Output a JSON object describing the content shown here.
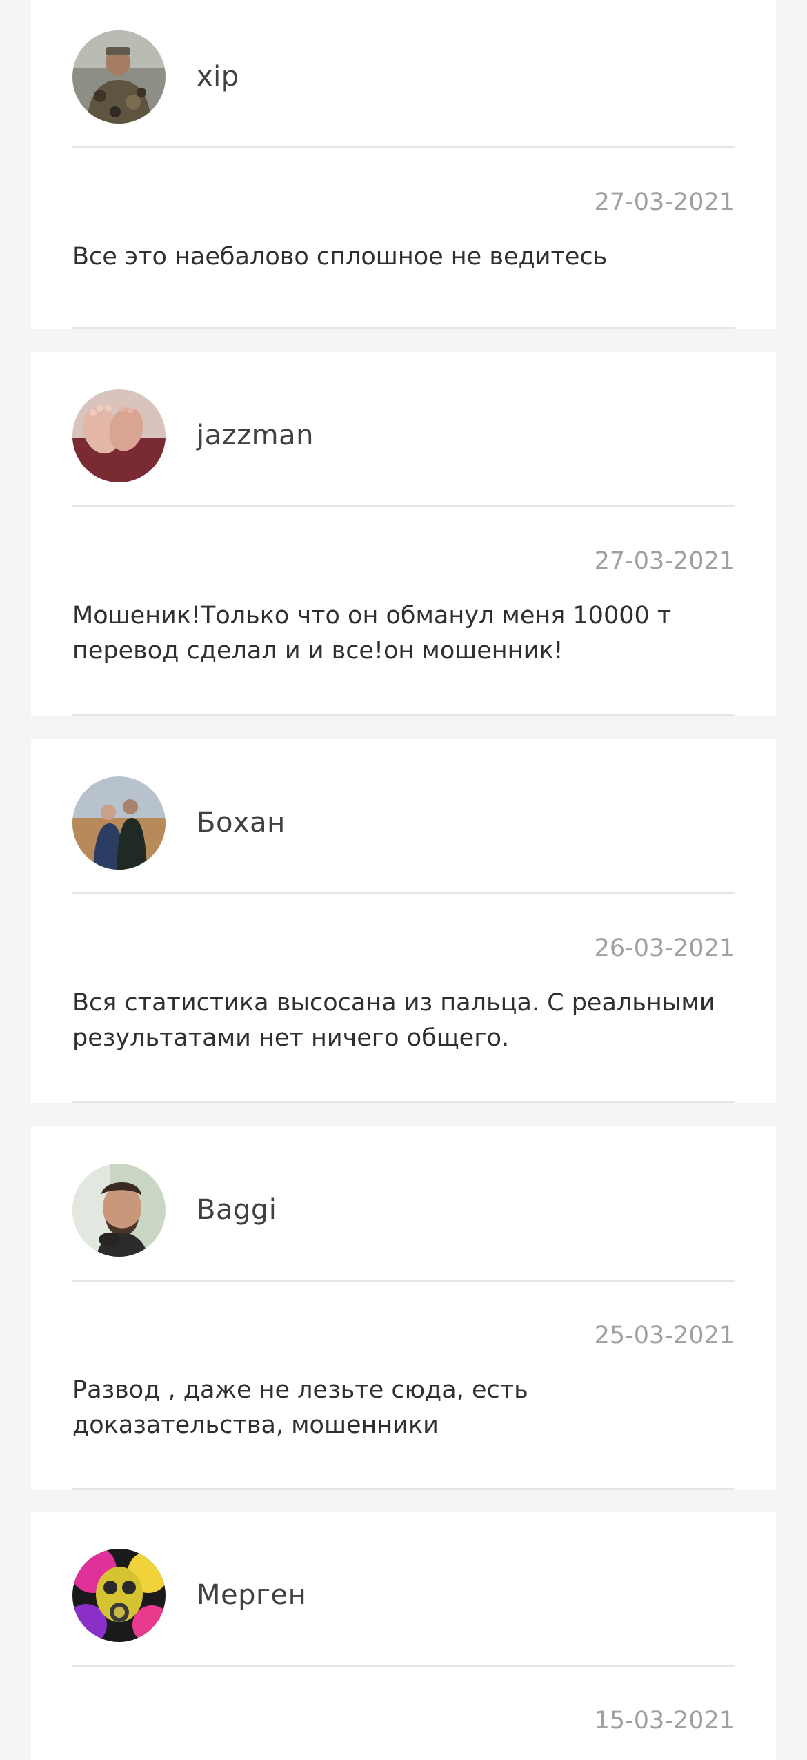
{
  "reviews": [
    {
      "username": "xip",
      "date": "27-03-2021",
      "text": "Все это наебалово сплошное не ведитесь",
      "avatar_icon": "user-photo-camouflage"
    },
    {
      "username": "jazzman",
      "date": "27-03-2021",
      "text": "Мошеник!Только что он обманул меня 10000 т перевод сделал и и все!он мошенник!",
      "avatar_icon": "user-photo-baby-feet"
    },
    {
      "username": "Бохан",
      "date": "26-03-2021",
      "text": "Вся статистика высосана из пальца. С реальными результатами нет ничего общего.",
      "avatar_icon": "user-photo-couple"
    },
    {
      "username": "Baggi",
      "date": "25-03-2021",
      "text": "Развод , даже не лезьте сюда, есть доказательства, мошенники",
      "avatar_icon": "user-photo-portrait"
    },
    {
      "username": "Мерген",
      "date": "15-03-2021",
      "text": "",
      "avatar_icon": "user-photo-gas-mask-colorful"
    }
  ],
  "colors": {
    "page_background": "#f5f5f5",
    "card_background": "#ffffff",
    "divider": "#e6e6e6",
    "username": "#404040",
    "date": "#a0a0a0",
    "comment": "#2f2f2f"
  }
}
